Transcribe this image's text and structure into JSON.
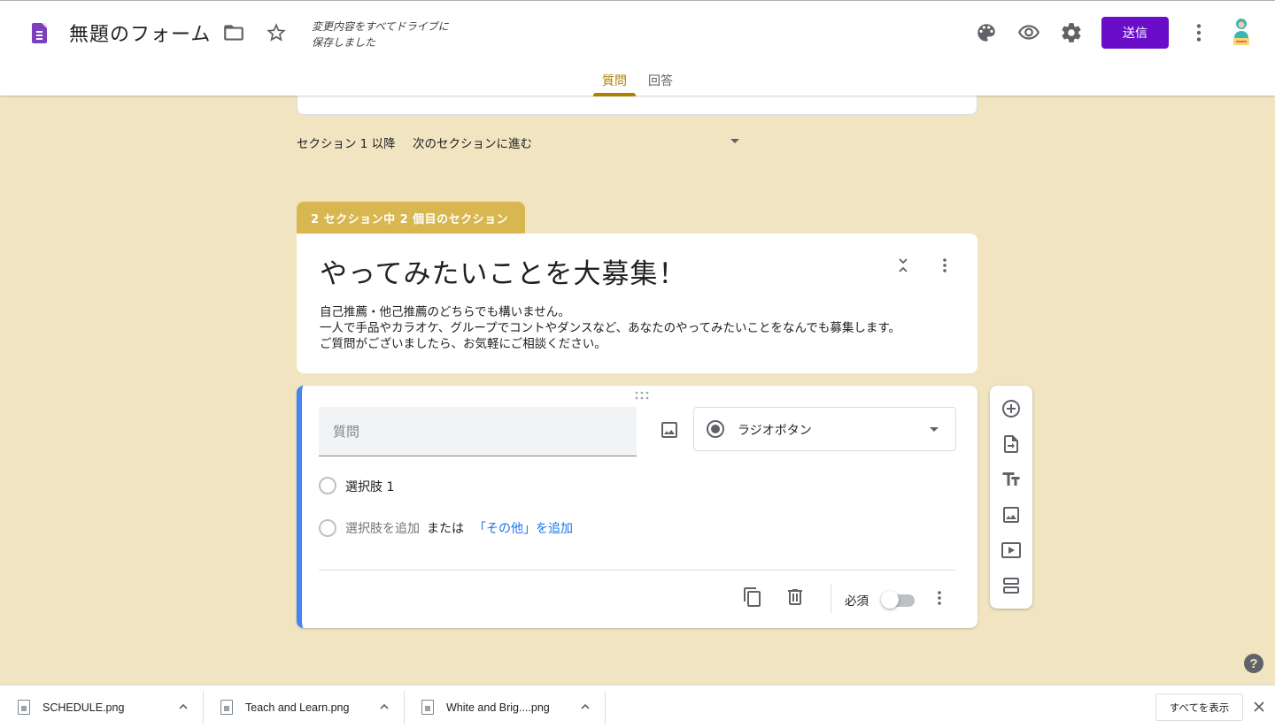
{
  "header": {
    "title": "無題のフォーム",
    "save_status_line1": "変更内容をすべてドライブに",
    "save_status_line2": "保存しました",
    "send_label": "送信",
    "tabs": [
      {
        "label": "質問",
        "active": true
      },
      {
        "label": "回答",
        "active": false
      }
    ],
    "accent_color": "#6a0dc8"
  },
  "section_nav": {
    "after_label": "セクション 1 以降",
    "after_value": "次のセクションに進む"
  },
  "section": {
    "badge": "2 セクション中 2 個目のセクション",
    "title": "やってみたいことを大募集！",
    "description": [
      "自己推薦・他己推薦のどちらでも構いません。",
      "一人で手品やカラオケ、グループでコントやダンスなど、あなたのやってみたいことをなんでも募集します。",
      "ご質問がございましたら、お気軽にご相談ください。"
    ],
    "badge_color": "#d8b751"
  },
  "question": {
    "placeholder": "質問",
    "type_label": "ラジオボタン",
    "options": [
      "選択肢 1"
    ],
    "add_option": "選択肢を追加",
    "or_text": "または",
    "add_other": "「その他」を追加",
    "required_label": "必須",
    "required": false
  },
  "side_toolbar": [
    "add-question-icon",
    "import-questions-icon",
    "add-title-icon",
    "add-image-icon",
    "add-video-icon",
    "add-section-icon"
  ],
  "downloads": {
    "items": [
      {
        "name": "SCHEDULE.png"
      },
      {
        "name": "Teach and Learn.png"
      },
      {
        "name": "White and Brig....png"
      }
    ],
    "show_all": "すべてを表示"
  },
  "background_color": "#f0e4c1"
}
